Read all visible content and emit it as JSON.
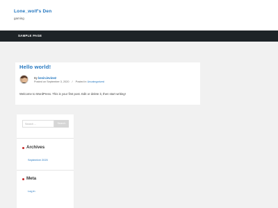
{
  "header": {
    "site_title": "Lone_wolf's Den",
    "site_description": "gaming"
  },
  "nav": {
    "items": [
      {
        "label": "SAMPLE PAGE"
      }
    ]
  },
  "post": {
    "title": "Hello world!",
    "by_prefix": "By",
    "author": "kevin.levine2",
    "posted_on_prefix": "Posted on",
    "date": "September 3, 2020",
    "separator": "/",
    "posted_in_prefix": "Posted in",
    "category": "Uncategorized",
    "excerpt": "Welcome to WordPress. This is your first post. Edit or delete it, then start writing!"
  },
  "sidebar": {
    "search": {
      "placeholder": "Search ...",
      "button_label": "Search"
    },
    "archives": {
      "title": "Archives",
      "items": [
        "September 2020"
      ]
    },
    "meta": {
      "title": "Meta",
      "items": [
        "Log in"
      ]
    }
  },
  "colors": {
    "link": "#1e73be",
    "nav_bg": "#1d2327",
    "bullet": "#c62828",
    "page_bg": "#f1f1f1"
  }
}
